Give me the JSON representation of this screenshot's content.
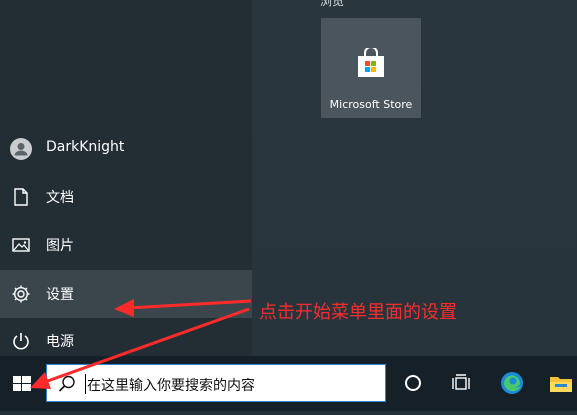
{
  "top_label": "浏览",
  "tile": {
    "label": "Microsoft Store",
    "icon": "store-icon"
  },
  "menu": [
    {
      "name": "user",
      "label": "DarkKnight",
      "icon": "avatar-icon"
    },
    {
      "name": "documents",
      "label": "文档",
      "icon": "document-icon"
    },
    {
      "name": "pictures",
      "label": "图片",
      "icon": "pictures-icon"
    },
    {
      "name": "settings",
      "label": "设置",
      "icon": "gear-icon",
      "active": true
    },
    {
      "name": "power",
      "label": "电源",
      "icon": "power-icon"
    }
  ],
  "search": {
    "placeholder": "在这里输入你要搜索的内容"
  },
  "annotation": "点击开始菜单里面的设置",
  "taskbar_icons": [
    "cortana-icon",
    "task-view-icon",
    "edge-icon",
    "file-explorer-icon"
  ],
  "colors": {
    "annotation": "#ff2b2b",
    "accent": "#2e86d6"
  }
}
